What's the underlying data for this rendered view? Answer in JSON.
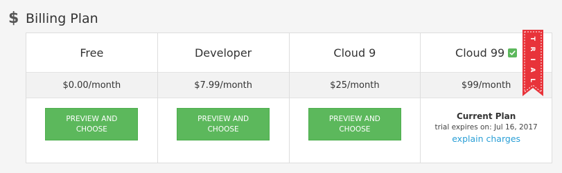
{
  "section": {
    "icon": "dollar-icon",
    "icon_glyph": "$",
    "title": "Billing Plan"
  },
  "plans": [
    {
      "name": "Free",
      "price": "$0.00/month",
      "action_label": "PREVIEW AND CHOOSE"
    },
    {
      "name": "Developer",
      "price": "$7.99/month",
      "action_label": "PREVIEW AND CHOOSE"
    },
    {
      "name": "Cloud 9",
      "price": "$25/month",
      "action_label": "PREVIEW AND CHOOSE"
    },
    {
      "name": "Cloud 99",
      "price": "$99/month",
      "is_current": true,
      "current_label": "Current Plan",
      "trial_expires": "trial expires on: Jul 16, 2017",
      "explain_link": "explain charges",
      "ribbon_text": "TRIAL"
    }
  ],
  "colors": {
    "button_green": "#5cb85c",
    "link_blue": "#2a9fd6",
    "ribbon_red": "#e8333a"
  }
}
